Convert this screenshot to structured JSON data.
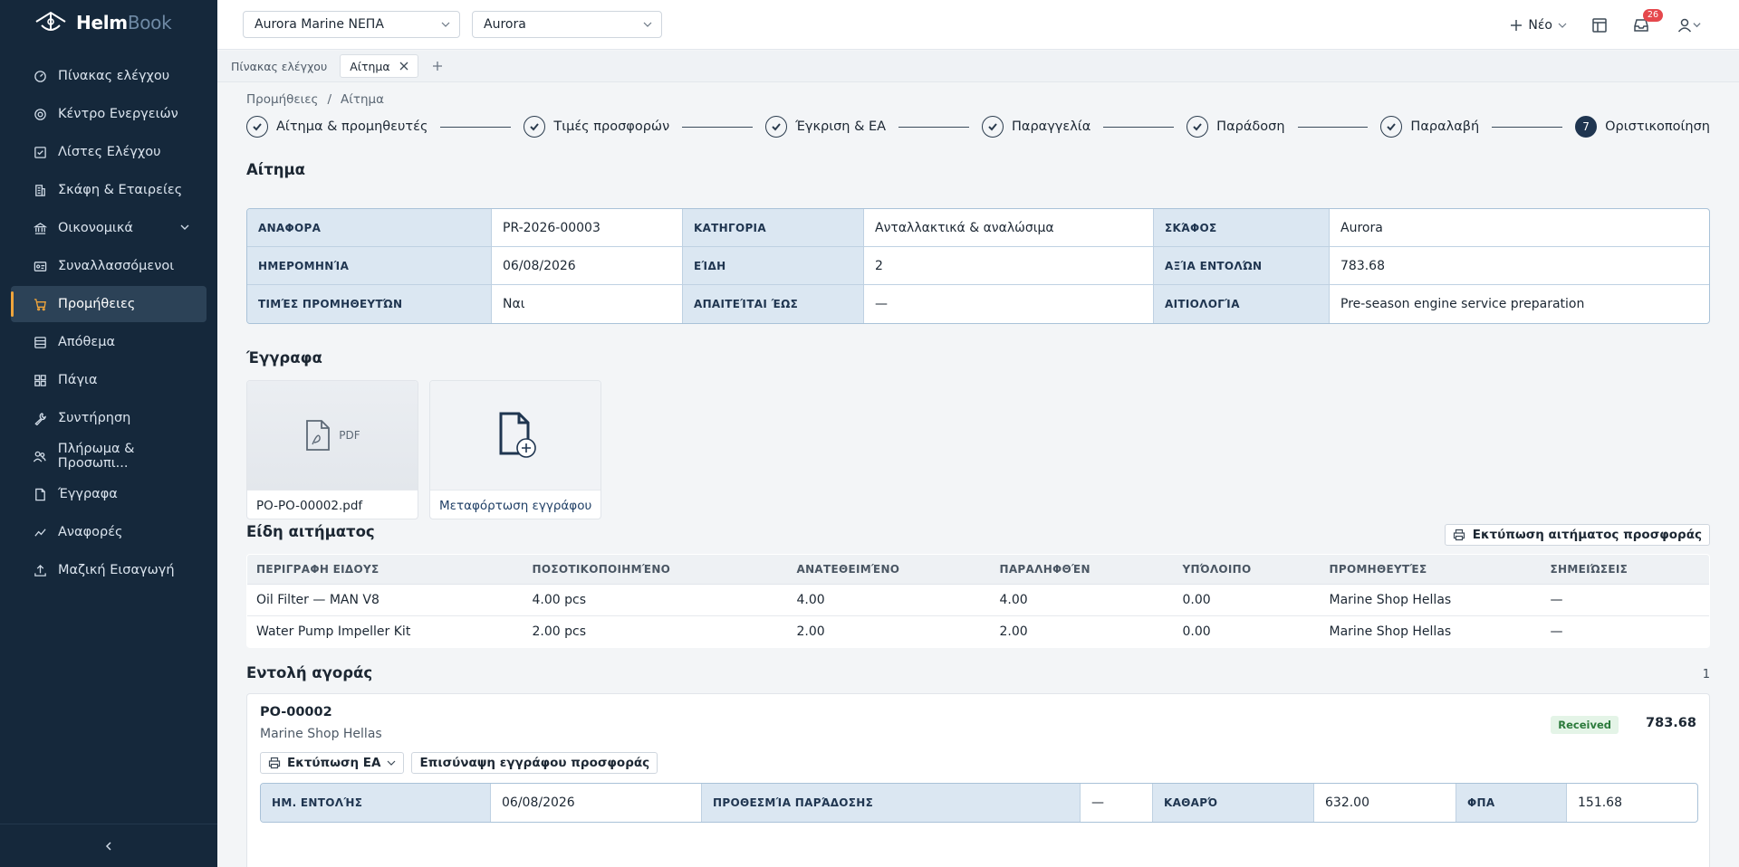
{
  "brand": {
    "name_bold": "Helm",
    "name_light": "Book"
  },
  "sidebar": {
    "items": [
      {
        "label": "Πίνακας ελέγχου",
        "icon": "gauge-icon"
      },
      {
        "label": "Κέντρο Ενεργειών",
        "icon": "target-icon"
      },
      {
        "label": "Λίστες Ελέγχου",
        "icon": "checkbox-icon"
      },
      {
        "label": "Σκάφη & Εταιρείες",
        "icon": "building-icon"
      },
      {
        "label": "Οικονομικά",
        "icon": "bank-icon"
      },
      {
        "label": "Συναλλασσόμενοι",
        "icon": "id-card-icon"
      },
      {
        "label": "Προμήθειες",
        "icon": "cart-icon"
      },
      {
        "label": "Απόθεμα",
        "icon": "box-icon"
      },
      {
        "label": "Πάγια",
        "icon": "grid-icon"
      },
      {
        "label": "Συντήρηση",
        "icon": "wrench-icon"
      },
      {
        "label": "Πλήρωμα & Προσωπι...",
        "icon": "people-icon"
      },
      {
        "label": "Έγγραφα",
        "icon": "file-icon"
      },
      {
        "label": "Αναφορές",
        "icon": "chart-icon"
      },
      {
        "label": "Μαζική Εισαγωγή",
        "icon": "upload-icon"
      }
    ],
    "active_index": 6
  },
  "topbar": {
    "company_select": "Aurora Marine ΝΕΠΑ",
    "vessel_select": "Aurora",
    "new_label": "Νέο",
    "notifications_count": "26"
  },
  "tabs": [
    {
      "label": "Πίνακας ελέγχου"
    },
    {
      "label": "Αίτημα"
    }
  ],
  "breadcrumb": {
    "parent": "Προμήθειες",
    "sep": "/",
    "current": "Αίτημα"
  },
  "steps": [
    {
      "label": "Αίτημα & προμηθευτές",
      "done": true
    },
    {
      "label": "Τιμές προσφορών",
      "done": true
    },
    {
      "label": "Έγκριση & ΕΑ",
      "done": true
    },
    {
      "label": "Παραγγελία",
      "done": true
    },
    {
      "label": "Παράδοση",
      "done": true
    },
    {
      "label": "Παραλαβή",
      "done": true
    },
    {
      "label": "Οριστικοποίηση",
      "done": false,
      "number": "7"
    }
  ],
  "request": {
    "title": "Αίτημα",
    "reference_label": "ΑΝΑΦΟΡΑ",
    "reference": "PR-2026-00003",
    "category_label": "ΚΑΤΗΓΟΡΙΑ",
    "category": "Ανταλλακτικά & αναλώσιμα",
    "vessel_label": "ΣΚΆΦΟΣ",
    "vessel": "Aurora",
    "date_label": "ΗΜΕΡΟΜΗΝΊΑ",
    "date": "06/08/2026",
    "items_label": "ΕΊΔΗ",
    "items": "2",
    "value_label": "ΑΞΊΑ ΕΝΤΟΛΏΝ",
    "value": "783.68",
    "quotes_label": "ΤΙΜΈΣ ΠΡΟΜΗΘΕΥΤΏΝ",
    "quotes": "Ναι",
    "required_label": "ΑΠΑΙΤΕΊΤΑΙ ΈΩΣ",
    "required": "—",
    "reason_label": "ΑΙΤΙΟΛΟΓΊΑ",
    "reason": "Pre-season engine service preparation"
  },
  "documents": {
    "title": "Έγγραφα",
    "files": [
      {
        "name": "PO-PO-00002.pdf",
        "type": "PDF"
      }
    ],
    "upload_label": "Μεταφόρτωση εγγράφου"
  },
  "items": {
    "title": "Είδη αιτήματος",
    "print_label": "Εκτύπωση αιτήματος προσφοράς",
    "headers": [
      "ΠΕΡΙΓΡΑΦΗ ΕΙΔΟΥΣ",
      "ΠΟΣΟΤΙΚΟΠΟΙΗΜΈΝΟ",
      "ΑΝΑΤΕΘΕΙΜΈΝΟ",
      "ΠΑΡΑΛΗΦΘΈΝ",
      "ΥΠΌΛΟΙΠΟ",
      "ΠΡΟΜΗΘΕΥΤΈΣ",
      "ΣΗΜΕΙΏΣΕΙΣ"
    ],
    "rows": [
      [
        "Oil Filter — MAN V8",
        "4.00 pcs",
        "4.00",
        "4.00",
        "0.00",
        "Marine Shop Hellas",
        "—"
      ],
      [
        "Water Pump Impeller Kit",
        "2.00 pcs",
        "2.00",
        "2.00",
        "0.00",
        "Marine Shop Hellas",
        "—"
      ]
    ]
  },
  "purchase_order": {
    "title": "Εντολή αγοράς",
    "count": "1",
    "id": "PO-00002",
    "vendor": "Marine Shop Hellas",
    "status": "Received",
    "total": "783.68",
    "print_label": "Εκτύπωση ΕΑ",
    "attach_label": "Επισύναψη εγγράφου προσφοράς",
    "order_date_label": "ΗΜ. ΕΝΤΟΛΉΣ",
    "order_date": "06/08/2026",
    "deadline_label": "ΠΡΟΘΕΣΜΊΑ ΠΑΡΆΔΟΣΗΣ",
    "deadline": "—",
    "net_label": "ΚΑΘΑΡΌ",
    "net": "632.00",
    "vat_label": "ΦΠΑ",
    "vat": "151.68"
  }
}
